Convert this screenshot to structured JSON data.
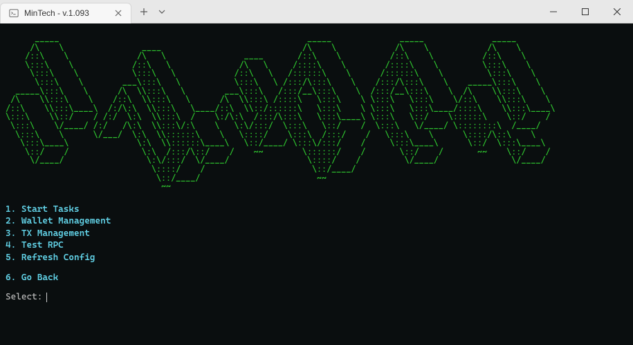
{
  "window": {
    "tab_title": "MinTech - v.1.093"
  },
  "ascii": "      _____                                                   _____              _____              _____\n     /\\    \\                ____                             /\\    \\            /\\    \\            /\\    \\\n    /::\\    \\              /\\   \\                ____       /::\\    \\          /::\\    \\          /::\\    \\\n    \\:::\\    \\            /::\\   \\              /\\   \\     /::::\\    \\        /::::\\    \\         \\:::\\    \\\n     \\:::\\    \\           \\:::\\   \\            /::\\   \\   /::::::\\    \\      /::::::\\    \\         \\:::\\    \\\n      \\:::\\    \\        ___\\:::\\   \\           \\:::\\   \\ /:::/\\:::\\    \\    /:::/\\:::\\    \\    _____\\:::\\    \\\n  _____\\:::\\    \\      /\\  \\\\:::\\   \\        ___\\:::\\   /:::/__\\:::\\    \\  /:::/__\\:::\\    \\  /\\    \\\\:::\\    \\\n /\\    \\\\:::\\    \\    /::\\  \\\\:::\\   \\      /\\  \\\\:::\\ /::::\\   \\:::\\    \\ \\:::\\   \\:::\\    \\/::\\    \\\\:::\\    \\\n/::\\    \\\\:::\\____\\  /:/\\:\\  \\\\:::\\   \\____/::\\  \\\\::/::::::\\   \\:::\\    \\ \\:::\\   \\:::\\____/::::\\    \\\\:::\\____\\\n\\:::\\    \\\\::/    / /:/  \\:\\  \\\\:::\\  /    \\:/\\:\\  /:::/\\:::\\   \\:::\\____\\ \\:::\\   \\::/    \\::::::\\    \\::/    /\n \\:::\\    \\/____/ /:/   /\\:\\  \\\\:::\\/:\\    \\   \\:\\/:::/  \\:::\\   \\::/    /  \\:::\\   \\/____/ \\::::::::\\  /____/\n  \\:::\\    \\      \\/___/  \\:\\  \\\\::::::\\    \\   \\::::/    \\:::\\  /:::/    /   \\:::\\    \\      \\::::/\\::\\    \\\n   \\:::\\____\\              \\:\\  \\\\::::::\\____\\   \\::/____/ \\:::\\/:::/    /     \\:::\\____\\      \\::/  \\:::\\____\\\n    \\::/    /               \\:\\  /:::/\\::/    /    ~~        \\::::::/    /       \\::/    /       ~~    \\::/    /\n     \\/____/                 \\:\\/:::/  \\/____/                \\::::/    /         \\/____/               \\/____/\n                              \\::::/    /                      \\::/____/\n                               \\::/____/                        ~~\n                                ~~",
  "menu": {
    "items": [
      {
        "num": "1.",
        "label": "Start Tasks"
      },
      {
        "num": "2.",
        "label": "Wallet Management"
      },
      {
        "num": "3.",
        "label": "TX Management"
      },
      {
        "num": "4.",
        "label": "Test RPC"
      },
      {
        "num": "5.",
        "label": "Refresh Config"
      }
    ],
    "back": {
      "num": "6.",
      "label": "Go Back"
    }
  },
  "prompt": {
    "label": "Select:",
    "value": ""
  }
}
